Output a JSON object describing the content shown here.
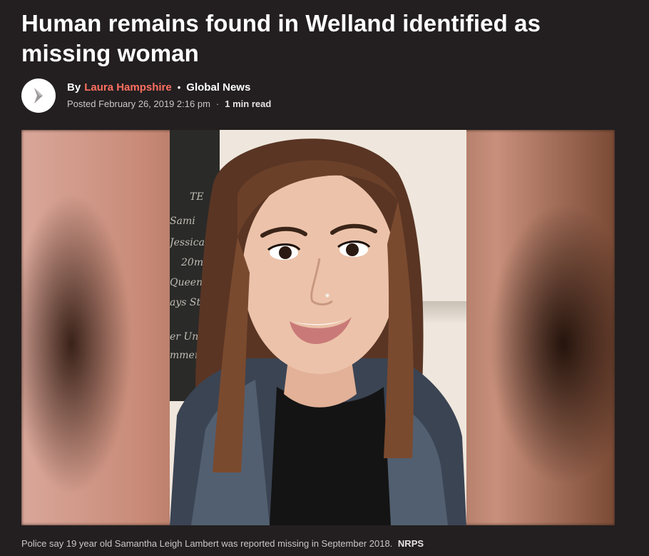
{
  "article": {
    "headline": "Human remains found in Welland identified as missing woman",
    "byline": {
      "by": "By",
      "author": "Laura Hampshire",
      "dot": "•",
      "outlet": "Global News",
      "posted": "Posted February 26, 2019 2:16 pm",
      "separator": "·",
      "read_time": "1 min read"
    },
    "image": {
      "caption": "Police say 19 year old Samantha Leigh Lambert was reported missing in September 2018.",
      "credit": "NRPS",
      "chalk_lines": [
        "TE",
        "Sami",
        "Jessica",
        "20m",
        "Queen",
        "ays Str",
        "er Unde",
        "mmer"
      ]
    }
  },
  "colors": {
    "background": "#231f20",
    "author_link": "#ff6f61",
    "text": "#ffffff",
    "muted": "#c9c6c6"
  },
  "icons": {
    "logo": "global-news-chevron-logo"
  }
}
